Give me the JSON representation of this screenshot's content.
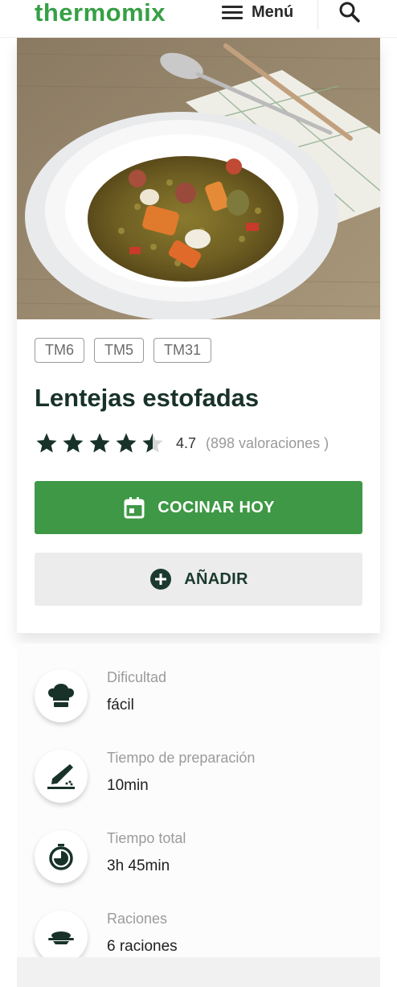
{
  "header": {
    "logo": "thermomix",
    "menu_label": "Menú"
  },
  "recipe": {
    "devices": [
      "TM6",
      "TM5",
      "TM31"
    ],
    "title": "Lentejas estofadas",
    "rating": {
      "stars": 4.7,
      "value": "4.7",
      "count": "(898 valoraciones )"
    },
    "actions": {
      "cook_label": "COCINAR HOY",
      "add_label": "AÑADIR"
    }
  },
  "details": [
    {
      "icon": "chef-hat-icon",
      "label": "Dificultad",
      "value": "fácil"
    },
    {
      "icon": "knife-icon",
      "label": "Tiempo de preparación",
      "value": "10min"
    },
    {
      "icon": "timer-icon",
      "label": "Tiempo total",
      "value": "3h 45min"
    },
    {
      "icon": "serving-dish-icon",
      "label": "Raciones",
      "value": "6 raciones"
    }
  ],
  "colors": {
    "brand_green": "#36a045",
    "button_green": "#3e9845",
    "dark_green": "#18322a"
  }
}
